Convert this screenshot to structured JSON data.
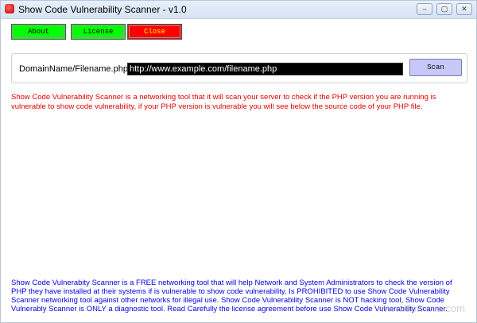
{
  "window": {
    "title": "Show Code Vulnerability Scanner - v1.0",
    "controls": {
      "minimize": "‒",
      "maximize": "▢",
      "close": "✕"
    }
  },
  "toolbar": {
    "about_label": "About",
    "license_label": "License",
    "close_label": "Close"
  },
  "scan": {
    "field_label": "DomainName/Filename.php",
    "url_value": "http://www.example.com/filename.php",
    "scan_label": "Scan"
  },
  "descriptions": {
    "red": "Show Code Vulnerability Scanner is a networking tool that it will scan your server to check if the PHP version you are running is vulnerable to show code vulnerability, if your PHP version is vulnerable you will see below the source code of your PHP file.",
    "blue": "Show Code Vulnerabity Scanner is a FREE networking tool that will help Network and System Administrators to check the version of PHP they have installed at their systems if is vulnerable to show code vulnerability. Is PROHIBITED to use Show Code Vulnerability Scanner networking tool against other networks for illegal use. Show Code Vulnerability Scanner is NOT hacking tool, Show Code Vulnerably Scanner is ONLY a diagnostic tool. Read Carefully the license agreement before use Show Code Vulnerability Scanner."
  },
  "watermark": "www.downxia.com",
  "colors": {
    "green_button": "#00ff00",
    "red_button": "#ff0000",
    "scan_button": "#c8c8f8",
    "red_text": "#e00000",
    "blue_text": "#0000e0"
  }
}
